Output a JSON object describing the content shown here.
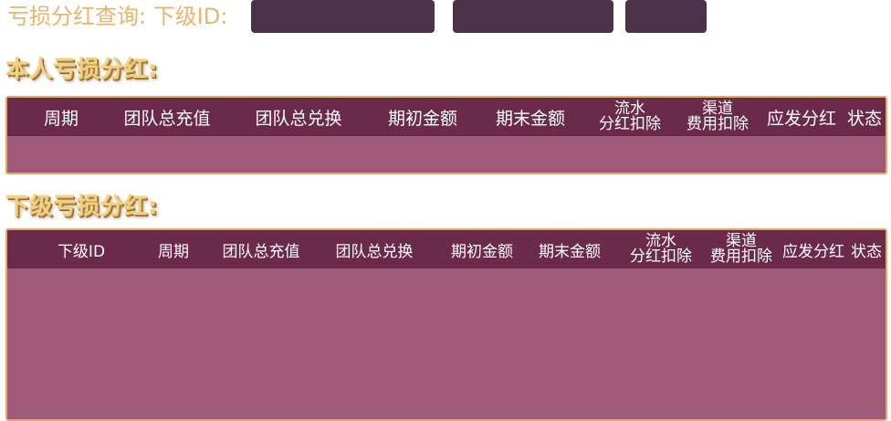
{
  "query": {
    "label": "亏损分红查询: 下级ID:",
    "id_input_value": "",
    "second_input_value": "",
    "search_button_label": ""
  },
  "colors": {
    "gold_text": "#e8b56a",
    "input_bg": "#4b3248",
    "header_bg": "#6b2a49",
    "body_bg": "#9f5a79",
    "frame_border": "#e3a965"
  },
  "own_section": {
    "title": "本人亏损分红:",
    "columns": [
      {
        "line1": "周期",
        "line2": ""
      },
      {
        "line1": "团队总充值",
        "line2": ""
      },
      {
        "line1": "团队总兑换",
        "line2": ""
      },
      {
        "line1": "期初金额",
        "line2": ""
      },
      {
        "line1": "期末金额",
        "line2": ""
      },
      {
        "line1": "流水",
        "line2": "分红扣除"
      },
      {
        "line1": "渠道",
        "line2": "费用扣除"
      },
      {
        "line1": "应发分红",
        "line2": ""
      },
      {
        "line1": "状态",
        "line2": ""
      }
    ],
    "rows": []
  },
  "sub_section": {
    "title": "下级亏损分红:",
    "columns": [
      {
        "line1": "下级ID",
        "line2": ""
      },
      {
        "line1": "周期",
        "line2": ""
      },
      {
        "line1": "团队总充值",
        "line2": ""
      },
      {
        "line1": "团队总兑换",
        "line2": ""
      },
      {
        "line1": "期初金额",
        "line2": ""
      },
      {
        "line1": "期末金额",
        "line2": ""
      },
      {
        "line1": "流水",
        "line2": "分红扣除"
      },
      {
        "line1": "渠道",
        "line2": "费用扣除"
      },
      {
        "line1": "应发分红",
        "line2": ""
      },
      {
        "line1": "状态",
        "line2": ""
      }
    ],
    "rows": []
  }
}
